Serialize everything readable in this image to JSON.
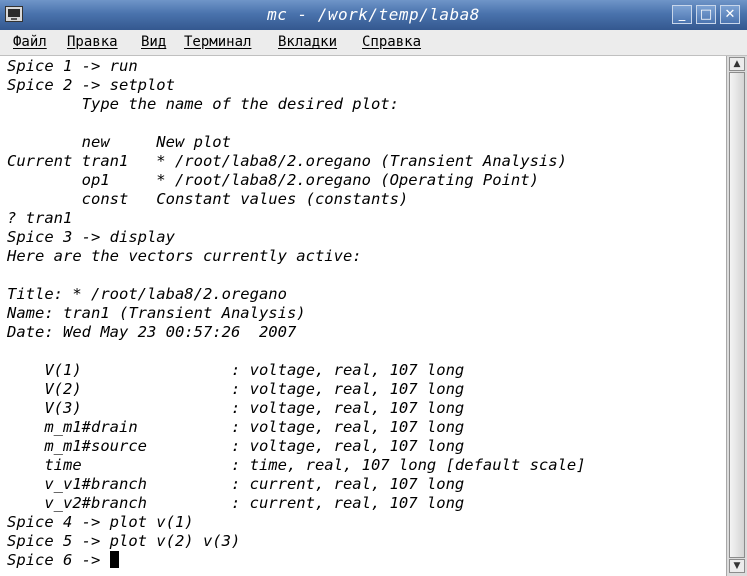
{
  "window": {
    "title": "mc - /work/temp/laba8",
    "minimize_label": "_",
    "maximize_label": "□",
    "close_label": "✕"
  },
  "menu": {
    "items": [
      {
        "label": "Файл"
      },
      {
        "label": "Правка"
      },
      {
        "label": "Вид"
      },
      {
        "label": "Терминал"
      },
      {
        "label": "Вкладки"
      },
      {
        "label": "Справка"
      }
    ]
  },
  "terminal": {
    "lines": [
      "Spice 1 -> run",
      "Spice 2 -> setplot",
      "        Type the name of the desired plot:",
      "",
      "        new     New plot",
      "Current tran1   * /root/laba8/2.oregano (Transient Analysis)",
      "        op1     * /root/laba8/2.oregano (Operating Point)",
      "        const   Constant values (constants)",
      "? tran1",
      "Spice 3 -> display",
      "Here are the vectors currently active:",
      "",
      "Title: * /root/laba8/2.oregano",
      "Name: tran1 (Transient Analysis)",
      "Date: Wed May 23 00:57:26  2007",
      "",
      "    V(1)                : voltage, real, 107 long",
      "    V(2)                : voltage, real, 107 long",
      "    V(3)                : voltage, real, 107 long",
      "    m_m1#drain          : voltage, real, 107 long",
      "    m_m1#source         : voltage, real, 107 long",
      "    time                : time, real, 107 long [default scale]",
      "    v_v1#branch         : current, real, 107 long",
      "    v_v2#branch         : current, real, 107 long",
      "Spice 4 -> plot v(1)",
      "Spice 5 -> plot v(2) v(3)",
      "Spice 6 -> "
    ]
  },
  "scrollbar": {
    "up_icon": "▲",
    "down_icon": "▼"
  }
}
